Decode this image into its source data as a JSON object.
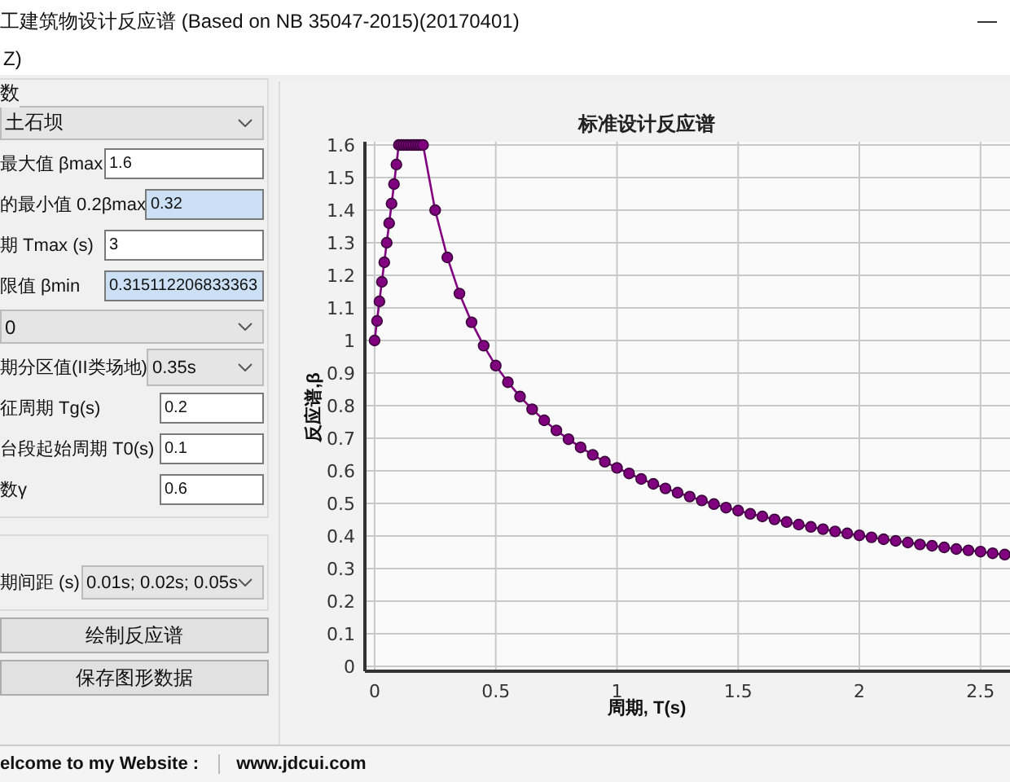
{
  "window": {
    "title": "工建筑物设计反应谱 (Based on NB 35047-2015)(20170401)"
  },
  "menu": [
    "Z)"
  ],
  "parameters": {
    "group_label": "数",
    "basic": [
      {
        "kind": "select",
        "value": "土石坝"
      },
      {
        "kind": "input",
        "label": "最大值 βmax",
        "value": "1.6",
        "highlighted": false
      },
      {
        "kind": "input",
        "label": "的最小值 0.2βmax",
        "value": "0.32",
        "highlighted": true
      },
      {
        "kind": "input",
        "label": "期 Tmax (s)",
        "value": "3",
        "highlighted": false
      },
      {
        "kind": "input",
        "label": "限值 βmin",
        "value": "0.315112206833363",
        "highlighted": true
      }
    ],
    "site": [
      {
        "kind": "select",
        "value": "0"
      },
      {
        "kind": "select",
        "label": "期分区值(II类场地)",
        "value": "0.35s"
      },
      {
        "kind": "input",
        "label": "征周期 Tg(s)",
        "value": "0.2",
        "highlighted": false
      },
      {
        "kind": "input",
        "label": "台段起始周期 T0(s)",
        "value": "0.1",
        "highlighted": false
      },
      {
        "kind": "input",
        "label": "数γ",
        "value": "0.6",
        "highlighted": false
      }
    ]
  },
  "interval": {
    "label": "期间距 (s)",
    "value": "0.01s; 0.02s; 0.05s"
  },
  "buttons": [
    "绘制反应谱",
    "保存图形数据"
  ],
  "status_bar": {
    "welcome": "elcome to my Website :",
    "website": "www.jdcui.com"
  },
  "chart": {
    "chart_data": {
      "type": "line",
      "title": "标准设计反应谱",
      "xlabel": "周期, T(s)",
      "ylabel": "反应谱,β",
      "x": [
        0,
        0.01,
        0.02,
        0.03,
        0.04,
        0.05,
        0.06,
        0.07,
        0.08,
        0.09,
        0.1,
        0.11,
        0.12,
        0.13,
        0.14,
        0.15,
        0.16,
        0.17,
        0.18,
        0.19,
        0.2,
        0.25,
        0.3,
        0.35,
        0.4,
        0.45,
        0.5,
        0.55,
        0.6,
        0.65,
        0.7,
        0.75,
        0.8,
        0.85,
        0.9,
        0.95,
        1,
        1.05,
        1.1,
        1.15,
        1.2,
        1.25,
        1.3,
        1.35,
        1.4,
        1.45,
        1.5,
        1.55,
        1.6,
        1.65,
        1.7,
        1.75,
        1.8,
        1.85,
        1.9,
        1.95,
        2,
        2.05,
        2.1,
        2.15,
        2.2,
        2.25,
        2.3,
        2.35,
        2.4,
        2.45,
        2.5,
        2.55,
        2.6
      ],
      "series": [
        {
          "color": "#800080",
          "marker": "circle",
          "values": [
            1,
            1.06,
            1.12,
            1.18,
            1.24,
            1.3,
            1.36,
            1.42,
            1.48,
            1.54,
            1.6,
            1.6,
            1.6,
            1.6,
            1.6,
            1.6,
            1.6,
            1.6,
            1.6,
            1.6,
            1.6,
            1.4,
            1.255,
            1.144,
            1.056,
            0.984,
            0.923,
            0.872,
            0.828,
            0.789,
            0.755,
            0.724,
            0.697,
            0.672,
            0.649,
            0.628,
            0.609,
            0.592,
            0.575,
            0.56,
            0.546,
            0.533,
            0.521,
            0.509,
            0.498,
            0.487,
            0.478,
            0.468,
            0.46,
            0.451,
            0.443,
            0.435,
            0.428,
            0.421,
            0.414,
            0.408,
            0.402,
            0.396,
            0.39,
            0.385,
            0.38,
            0.374,
            0.37,
            0.365,
            0.36,
            0.356,
            0.352,
            0.347,
            0.343
          ]
        }
      ],
      "grid": true,
      "xlim": [
        -0.04,
        2.635
      ],
      "ylim": [
        -0.015,
        1.61
      ],
      "xticks": [
        0,
        0.5,
        1,
        1.5,
        2,
        2.5
      ],
      "yticks": [
        0,
        0.1,
        0.2,
        0.3,
        0.4,
        0.5,
        0.6,
        0.7,
        0.8,
        0.9,
        1,
        1.1,
        1.2,
        1.3,
        1.4,
        1.5,
        1.6
      ]
    }
  }
}
